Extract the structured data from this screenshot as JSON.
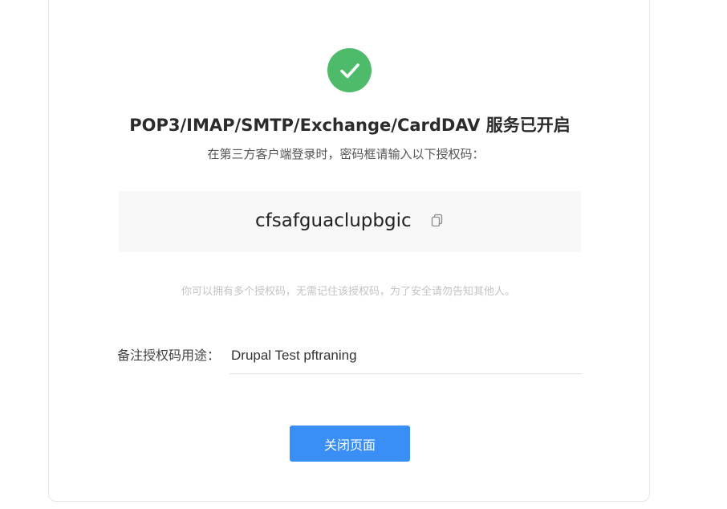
{
  "status": {
    "icon": "check-circle-icon",
    "title": "POP3/IMAP/SMTP/Exchange/CardDAV 服务已开启",
    "subtitle": "在第三方客户端登录时，密码框请输入以下授权码："
  },
  "auth_code": {
    "value": "cfsafguaclupbgic",
    "copy_icon": "copy-icon"
  },
  "hint": "你可以拥有多个授权码，无需记住该授权码，为了安全请勿告知其他人。",
  "note": {
    "label": "备注授权码用途：",
    "value": "Drupal Test pftraning"
  },
  "close_button": {
    "label": "关闭页面"
  },
  "colors": {
    "success": "#4dbb6a",
    "primary_button": "#3a8ff7",
    "code_background": "#f8f8f8"
  }
}
